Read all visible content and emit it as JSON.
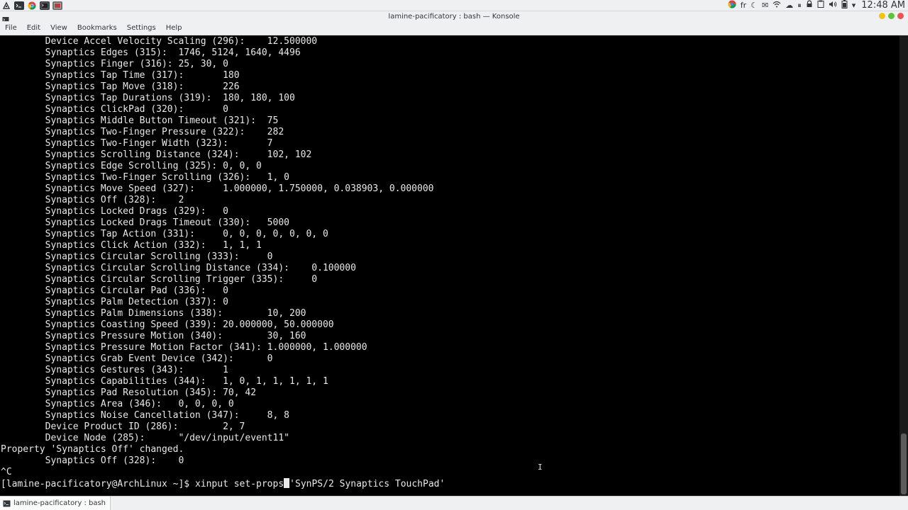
{
  "panel": {
    "locale": "fr",
    "clock": "12:48 AM"
  },
  "window": {
    "title": "lamine-pacificatory : bash — Konsole"
  },
  "menu": {
    "items": [
      "File",
      "Edit",
      "View",
      "Bookmarks",
      "Settings",
      "Help"
    ]
  },
  "terminal": {
    "lines": [
      "        Device Accel Velocity Scaling (296):    12.500000",
      "        Synaptics Edges (315):  1746, 5124, 1640, 4496",
      "        Synaptics Finger (316): 25, 30, 0",
      "        Synaptics Tap Time (317):       180",
      "        Synaptics Tap Move (318):       226",
      "        Synaptics Tap Durations (319):  180, 180, 100",
      "        Synaptics ClickPad (320):       0",
      "        Synaptics Middle Button Timeout (321):  75",
      "        Synaptics Two-Finger Pressure (322):    282",
      "        Synaptics Two-Finger Width (323):       7",
      "        Synaptics Scrolling Distance (324):     102, 102",
      "        Synaptics Edge Scrolling (325): 0, 0, 0",
      "        Synaptics Two-Finger Scrolling (326):   1, 0",
      "        Synaptics Move Speed (327):     1.000000, 1.750000, 0.038903, 0.000000",
      "        Synaptics Off (328):    2",
      "        Synaptics Locked Drags (329):   0",
      "        Synaptics Locked Drags Timeout (330):   5000",
      "        Synaptics Tap Action (331):     0, 0, 0, 0, 0, 0, 0",
      "        Synaptics Click Action (332):   1, 1, 1",
      "        Synaptics Circular Scrolling (333):     0",
      "        Synaptics Circular Scrolling Distance (334):    0.100000",
      "        Synaptics Circular Scrolling Trigger (335):     0",
      "        Synaptics Circular Pad (336):   0",
      "        Synaptics Palm Detection (337): 0",
      "        Synaptics Palm Dimensions (338):        10, 200",
      "        Synaptics Coasting Speed (339): 20.000000, 50.000000",
      "        Synaptics Pressure Motion (340):        30, 160",
      "        Synaptics Pressure Motion Factor (341): 1.000000, 1.000000",
      "        Synaptics Grab Event Device (342):      0",
      "        Synaptics Gestures (343):       1",
      "        Synaptics Capabilities (344):   1, 0, 1, 1, 1, 1, 1",
      "        Synaptics Pad Resolution (345): 70, 42",
      "        Synaptics Area (346):   0, 0, 0, 0",
      "        Synaptics Noise Cancellation (347):     8, 8",
      "        Device Product ID (286):        2, 7",
      "        Device Node (285):      \"/dev/input/event11\"",
      "Property 'Synaptics Off' changed.",
      "        Synaptics Off (328):    0",
      "^C"
    ],
    "prompt": "[lamine-pacificatory@ArchLinux ~]$ ",
    "command_before_cursor": "xinput set-props",
    "command_after_cursor": "'SynPS/2 Synaptics TouchPad'"
  },
  "taskbar": {
    "tab_label": "lamine-pacificatory : bash"
  }
}
